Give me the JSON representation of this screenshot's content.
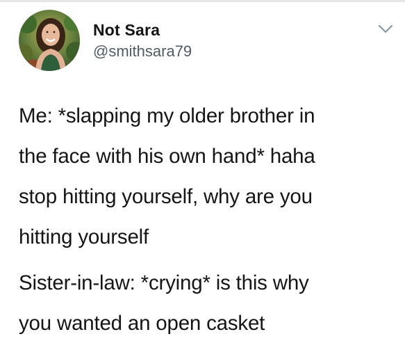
{
  "account": {
    "display_name": "Not Sara",
    "handle": "@smithsara79"
  },
  "icons": {
    "avatar": "profile-photo",
    "menu": "chevron-down-icon"
  },
  "colors": {
    "text": "#151515",
    "handle": "#505a63",
    "chevron": "#8899a6"
  },
  "tweet": {
    "paragraphs": [
      [
        "Me: *slapping my older brother in",
        "the face with his own hand* haha",
        "stop hitting yourself, why are you",
        "hitting yourself"
      ],
      [
        "Sister-in-law: *crying* is this why",
        "you wanted an open casket"
      ]
    ]
  }
}
